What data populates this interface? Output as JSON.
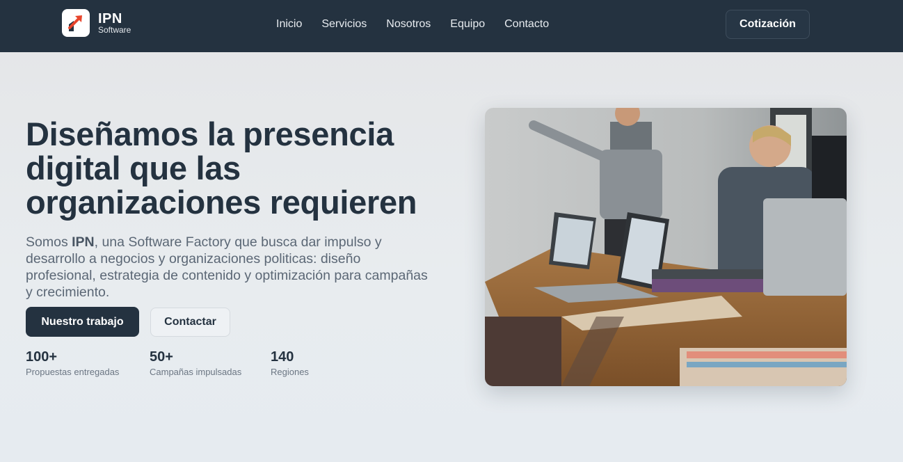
{
  "brand": {
    "name": "IPN",
    "sub": "Software"
  },
  "nav": {
    "links": [
      "Inicio",
      "Servicios",
      "Nosotros",
      "Equipo",
      "Contacto"
    ],
    "cta": "Cotización"
  },
  "hero": {
    "title": "Diseñamos la presencia digital que las organizaciones requieren",
    "desc_prefix": "Somos ",
    "desc_strong": "IPN",
    "desc_suffix": ", una Software Factory que busca dar impulso y desarrollo a negocios y organizaciones politicas: diseño profesional, estrategia de contenido y optimización para campañas y crecimiento.",
    "primary_button": "Nuestro trabajo",
    "secondary_button": "Contactar"
  },
  "stats": [
    {
      "value": "100+",
      "label": "Propuestas entregadas"
    },
    {
      "value": "50+",
      "label": "Campañas impulsadas"
    },
    {
      "value": "140",
      "label": "Regiones"
    }
  ],
  "colors": {
    "nav_bg": "#243240",
    "accent": "#e8452c",
    "text_dark": "#243240",
    "text_muted": "#5b6775"
  },
  "icons": {
    "logo": "rising-arrow-logo-icon"
  }
}
